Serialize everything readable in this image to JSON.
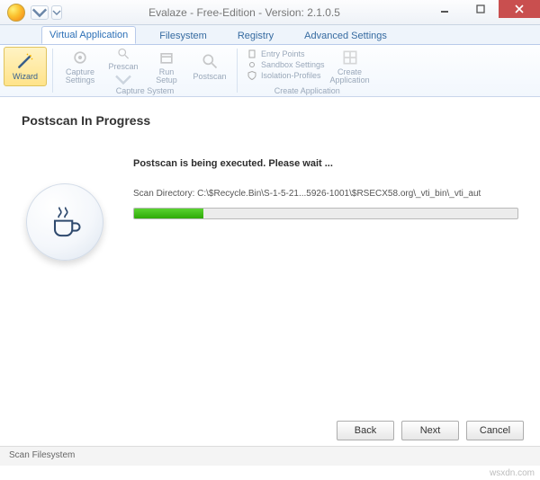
{
  "title": {
    "app": "Evalaze",
    "edition": "Free-Edition",
    "version_label": "Version:",
    "version": "2.1.0.5"
  },
  "tabs": [
    {
      "label": "Virtual Application",
      "active": true
    },
    {
      "label": "Filesystem"
    },
    {
      "label": "Registry"
    },
    {
      "label": "Advanced Settings"
    }
  ],
  "ribbon": {
    "wizard": "Wizard",
    "capture_settings": "Capture\nSettings",
    "prescan": "Prescan",
    "run_setup": "Run\nSetup",
    "postscan": "Postscan",
    "group_capture": "Capture System",
    "entry_points": "Entry Points",
    "sandbox_settings": "Sandbox Settings",
    "isolation_profiles": "Isolation-Profiles",
    "create_application": "Create\nApplication",
    "group_create": "Create Application"
  },
  "page": {
    "heading": "Postscan In Progress",
    "exec_msg": "Postscan is being executed. Please wait ...",
    "scan_label": "Scan Directory:",
    "scan_path": "C:\\$Recycle.Bin\\S-1-5-21...5926-1001\\$RSECX58.org\\_vti_bin\\_vti_aut",
    "progress_pct": 18
  },
  "buttons": {
    "back": "Back",
    "next": "Next",
    "cancel": "Cancel"
  },
  "status": "Scan Filesystem",
  "watermark": "wsxdn.com"
}
